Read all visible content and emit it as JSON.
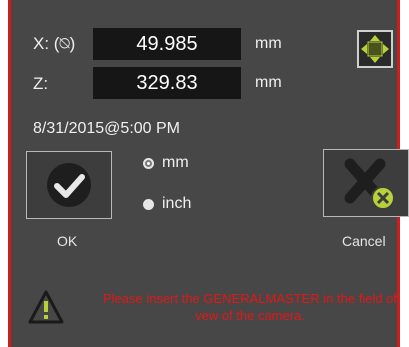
{
  "coordinates": {
    "x_label": "X: (⍉)",
    "x_value": "49.985",
    "x_unit": "mm",
    "z_label": "Z:",
    "z_value": "329.83",
    "z_unit": "mm"
  },
  "timestamp": "8/31/2015@5:00 PM",
  "units": {
    "options": [
      {
        "label": "mm",
        "selected": true
      },
      {
        "label": "inch",
        "selected": false
      }
    ]
  },
  "buttons": {
    "ok_label": "OK",
    "cancel_label": "Cancel"
  },
  "warning": {
    "message": "Please insert the GENERALMASTER in the field of vew of the camera."
  },
  "colors": {
    "accent_green": "#b8d13a",
    "warning_red": "#e01818",
    "border_red": "#d01c1c"
  },
  "icons": [
    "move-arrows-icon",
    "checkmark-icon",
    "cancel-x-icon",
    "warning-icon"
  ]
}
